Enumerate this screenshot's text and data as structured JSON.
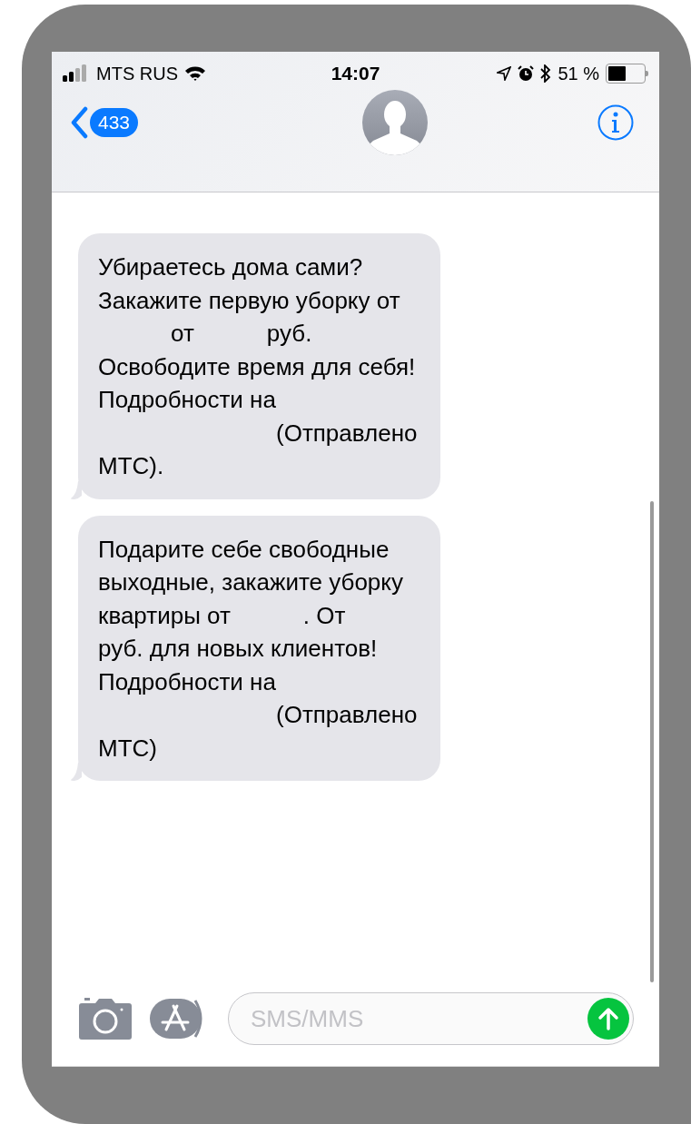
{
  "status_bar": {
    "carrier": "MTS RUS",
    "time": "14:07",
    "battery_text": "51 %",
    "battery": {
      "level": 0.51
    }
  },
  "header": {
    "back_count": "433"
  },
  "messages": [
    {
      "lines": [
        [
          {
            "kind": "text",
            "text": "Убираетесь дома сами?"
          }
        ],
        [
          {
            "kind": "text",
            "text": "Закажите первую уборку от"
          }
        ],
        [
          {
            "kind": "gap"
          },
          {
            "kind": "text",
            "text": "от"
          },
          {
            "kind": "gap"
          },
          {
            "kind": "text",
            "text": "руб."
          }
        ],
        [
          {
            "kind": "text",
            "text": "Освободите время для себя!"
          }
        ],
        [
          {
            "kind": "text",
            "text": "Подробности на"
          }
        ],
        [
          {
            "kind": "widegap"
          },
          {
            "kind": "text",
            "text": "(Отправлено"
          }
        ],
        [
          {
            "kind": "text",
            "text": "МТС)."
          }
        ]
      ]
    },
    {
      "lines": [
        [
          {
            "kind": "text",
            "text": "Подарите себе свободные"
          }
        ],
        [
          {
            "kind": "text",
            "text": "выходные, закажите уборку"
          }
        ],
        [
          {
            "kind": "text",
            "text": "квартиры от"
          },
          {
            "kind": "gap"
          },
          {
            "kind": "text",
            "text": ". От"
          }
        ],
        [
          {
            "kind": "text",
            "text": "руб. для новых клиентов!"
          }
        ],
        [
          {
            "kind": "text",
            "text": "Подробности на"
          }
        ],
        [
          {
            "kind": "widegap"
          },
          {
            "kind": "text",
            "text": "(Отправлено"
          }
        ],
        [
          {
            "kind": "text",
            "text": "МТС)"
          }
        ]
      ]
    }
  ],
  "composer": {
    "placeholder": "SMS/MMS"
  }
}
